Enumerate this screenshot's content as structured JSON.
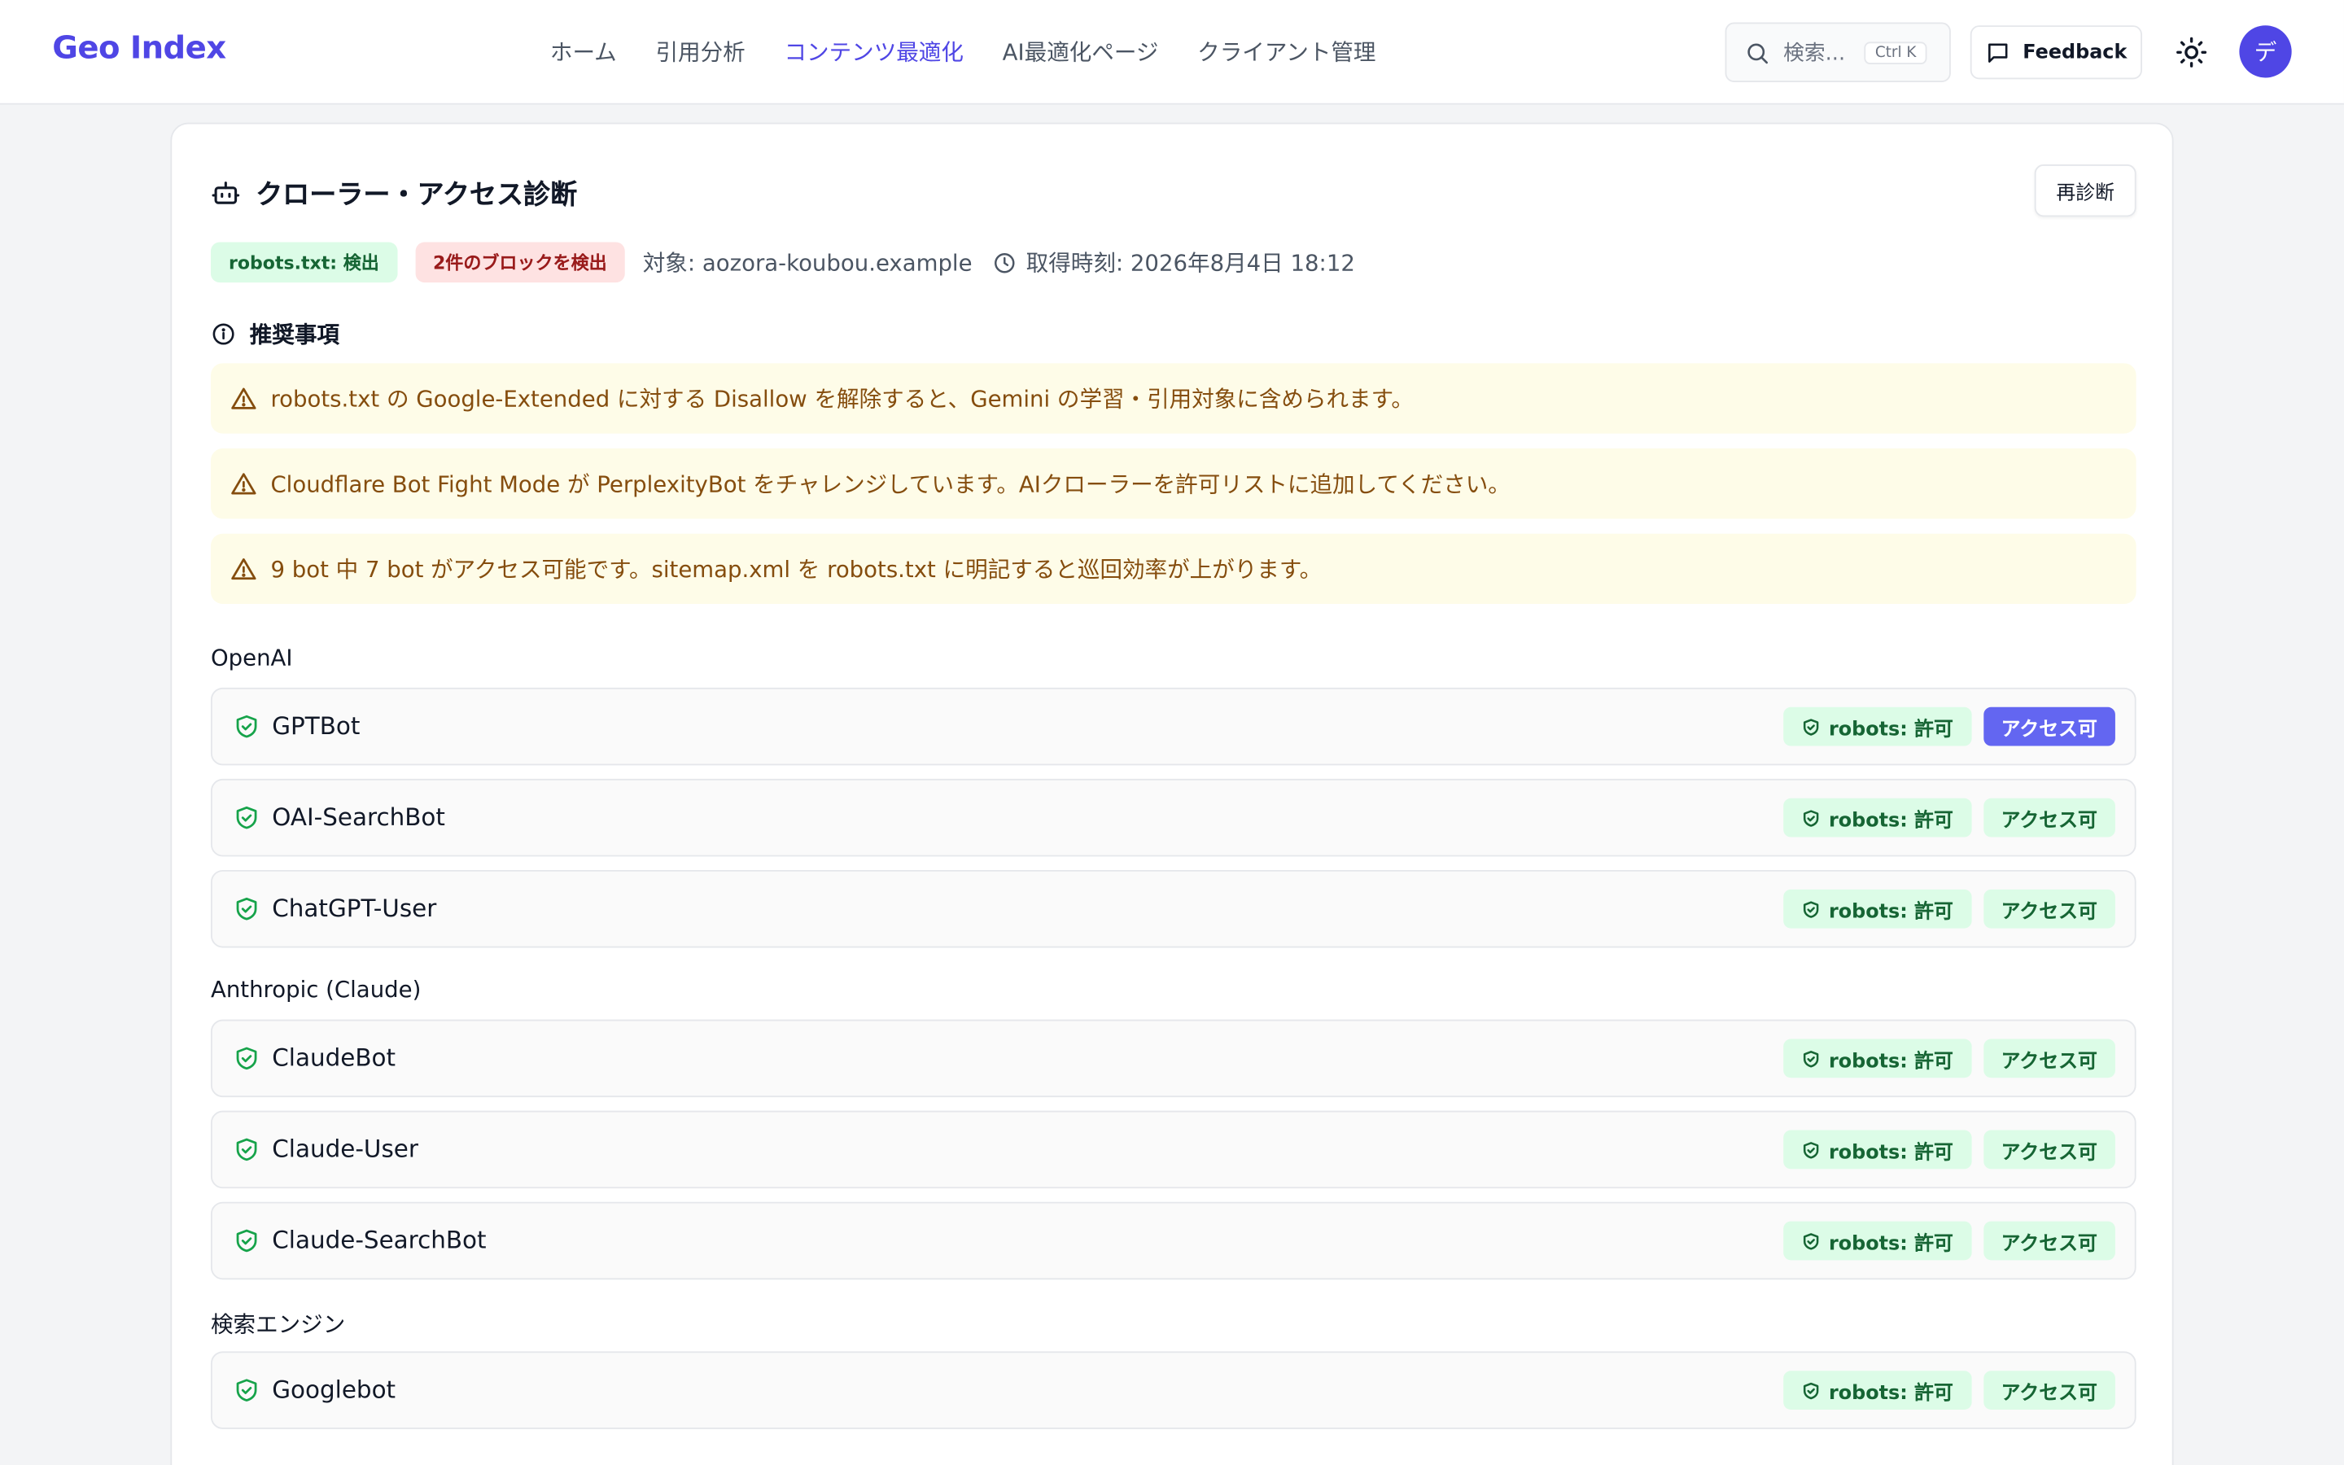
{
  "app": {
    "logo": "Geo Index"
  },
  "nav": [
    {
      "label": "ホーム",
      "active": false
    },
    {
      "label": "引用分析",
      "active": false
    },
    {
      "label": "コンテンツ最適化",
      "active": true
    },
    {
      "label": "AI最適化ページ",
      "active": false
    },
    {
      "label": "クライアント管理",
      "active": false
    }
  ],
  "search": {
    "placeholder": "検索...",
    "shortcut": "Ctrl K"
  },
  "feedback_label": "Feedback",
  "avatar_initial": "デ",
  "panel": {
    "title": "クローラー・アクセス診断",
    "rerun_label": "再診断",
    "robots_status": "robots.txt: 検出",
    "blocks_status": "2件のブロックを検出",
    "target": "対象: aozora-koubou.example",
    "fetched_at": "取得時刻: 2026年8月4日 18:12"
  },
  "recommendations": {
    "heading": "推奨事項",
    "items": [
      "robots.txt の Google-Extended に対する Disallow を解除すると、Gemini の学習・引用対象に含められます。",
      "Cloudflare Bot Fight Mode が PerplexityBot をチャレンジしています。AIクローラーを許可リストに追加してください。",
      "9 bot 中 7 bot がアクセス可能です。sitemap.xml を robots.txt に明記すると巡回効率が上がります。"
    ]
  },
  "groups": [
    {
      "name": "OpenAI",
      "bots": [
        {
          "name": "GPTBot",
          "robots": "robots: 許可",
          "access": "アクセス可",
          "highlighted": true
        },
        {
          "name": "OAI-SearchBot",
          "robots": "robots: 許可",
          "access": "アクセス可",
          "highlighted": false
        },
        {
          "name": "ChatGPT-User",
          "robots": "robots: 許可",
          "access": "アクセス可",
          "highlighted": false
        }
      ]
    },
    {
      "name": "Anthropic (Claude)",
      "bots": [
        {
          "name": "ClaudeBot",
          "robots": "robots: 許可",
          "access": "アクセス可",
          "highlighted": false
        },
        {
          "name": "Claude-User",
          "robots": "robots: 許可",
          "access": "アクセス可",
          "highlighted": false
        },
        {
          "name": "Claude-SearchBot",
          "robots": "robots: 許可",
          "access": "アクセス可",
          "highlighted": false
        }
      ]
    },
    {
      "name": "検索エンジン",
      "bots": [
        {
          "name": "Googlebot",
          "robots": "robots: 許可",
          "access": "アクセス可",
          "highlighted": false
        }
      ]
    }
  ],
  "colors": {
    "brand": "#4f46e5",
    "allow": "#166534",
    "warning": "#854d0e",
    "error": "#991b1b"
  }
}
